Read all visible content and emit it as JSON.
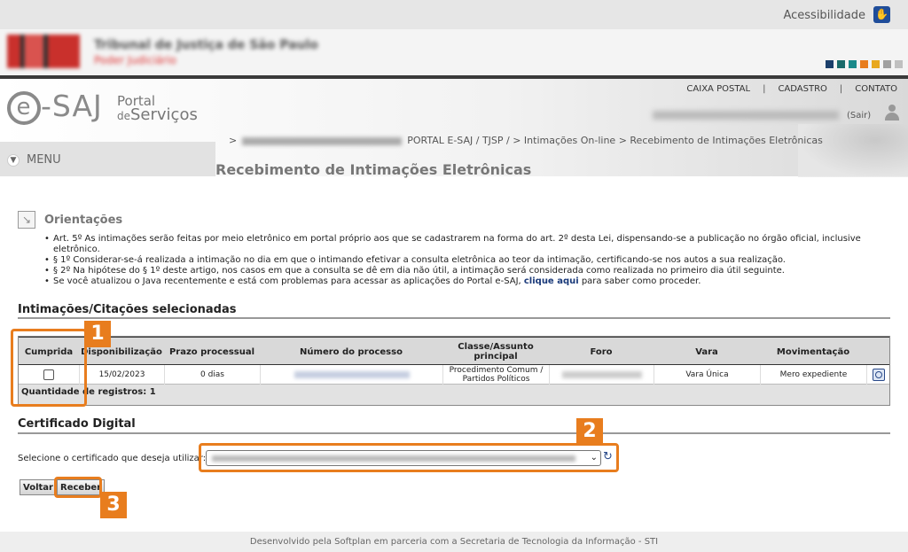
{
  "accessibility": {
    "label": "Acessibilidade"
  },
  "court": {
    "name": "Tribunal de Justiça de São Paulo",
    "sub": "Poder Judiciário"
  },
  "colors": {
    "accent": "#e87d1e",
    "link": "#1a3a7a",
    "swatches": [
      "#1b3f6b",
      "#1a6b6b",
      "#1a8a8a",
      "#e87d1e",
      "#e8a81e",
      "#a0a0a0",
      "#c0c0c0"
    ]
  },
  "topnav": {
    "caixa": "CAIXA POSTAL",
    "sep": "|",
    "cadastro": "CADASTRO",
    "contato": "CONTATO"
  },
  "user": {
    "sair": "(Sair)"
  },
  "logo": {
    "e": "e",
    "saj": "-SAJ",
    "portal": "Portal",
    "de": "de",
    "servicos": "Serviços"
  },
  "breadcrumb": {
    "lead": ">",
    "trail": "PORTAL E-SAJ / TJSP / > Intimações On-line > Recebimento de Intimações Eletrônicas"
  },
  "menu": {
    "label": "MENU"
  },
  "page": {
    "title": "Recebimento de Intimações Eletrônicas"
  },
  "orientacoes": {
    "title": "Orientações",
    "items": [
      "Art. 5º As intimações serão feitas por meio eletrônico em portal próprio aos que se cadastrarem na forma do art. 2º desta Lei, dispensando-se a publicação no órgão oficial, inclusive eletrônico.",
      "§ 1º Considerar-se-á realizada a intimação no dia em que o intimando efetivar a consulta eletrônica ao teor da intimação, certificando-se nos autos a sua realização.",
      "§ 2º Na hipótese do § 1º deste artigo, nos casos em que a consulta se dê em dia não útil, a intimação será considerada como realizada no primeiro dia útil seguinte."
    ],
    "java_pre": "Se você atualizou o Java recentemente e está com problemas para acessar as aplicações do Portal e-SAJ, ",
    "java_link": "clique aqui",
    "java_post": " para saber como proceder."
  },
  "intimacoes": {
    "title": "Intimações/Citações selecionadas",
    "headers": [
      "Cumprida",
      "Disponibilização",
      "Prazo processual",
      "Número do processo",
      "Classe/Assunto principal",
      "Foro",
      "Vara",
      "Movimentação"
    ],
    "row": {
      "disponibilizacao": "15/02/2023",
      "prazo": "0 dias",
      "classe": "Procedimento Comum / Partidos Políticos",
      "vara": "Vara Única",
      "movimentacao": "Mero expediente"
    },
    "count": "Quantidade de registros: 1"
  },
  "certificado": {
    "title": "Certificado Digital",
    "label": "Selecione o certificado que deseja utilizar:"
  },
  "buttons": {
    "voltar": "Voltar",
    "receber": "Receber"
  },
  "badges": {
    "one": "1",
    "two": "2",
    "three": "3"
  },
  "footer": {
    "text": "Desenvolvido pela Softplan em parceria com a Secretaria de Tecnologia da Informação - STI"
  }
}
